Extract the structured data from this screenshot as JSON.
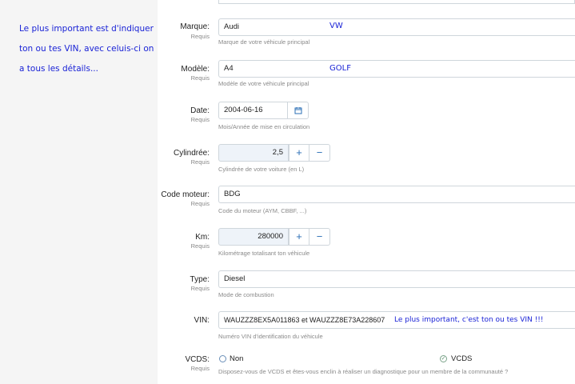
{
  "side_note": "Le plus important est d'indiquer ton ou tes VIN, avec celuis-ci on a tous les détails...",
  "required_label": "Requis",
  "fields": {
    "marque": {
      "label": "Marque:",
      "value": "Audi",
      "hint": "Marque de votre véhicule principal",
      "annotation": "VW"
    },
    "modele": {
      "label": "Modèle:",
      "value": "A4",
      "hint": "Modèle de votre véhicule principal",
      "annotation": "GOLF"
    },
    "date": {
      "label": "Date:",
      "value": "2004-06-16",
      "hint": "Mois/Année de mise en circulation"
    },
    "cylindree": {
      "label": "Cylindrée:",
      "value": "2,5",
      "hint": "Cylindrée de votre voiture (en L)"
    },
    "code_moteur": {
      "label": "Code moteur:",
      "value": "BDG",
      "hint": "Code du moteur (AYM, CBBF, ...)"
    },
    "km": {
      "label": "Km:",
      "value": "280000",
      "hint": "Kilométrage totalisant ton véhicule"
    },
    "type": {
      "label": "Type:",
      "value": "Diesel",
      "hint": "Mode de combustion"
    },
    "vin": {
      "label": "VIN:",
      "value": "WAUZZZ8EX5A011863 et WAUZZZ8E73A228607",
      "hint": "Numéro VIN d'identification du véhicule",
      "annotation": "Le plus important, c'est ton ou tes VIN !!!"
    },
    "vcds": {
      "label": "VCDS:",
      "option_no": "Non",
      "option_yes": "VCDS",
      "selected": "VCDS",
      "hint": "Disposez-vous de VCDS et êtes-vous enclin à réaliser un diagnostique pour un membre de la communauté ?"
    }
  },
  "steppers": {
    "plus": "+",
    "minus": "−"
  },
  "icons": {
    "calendar": "calendar-icon",
    "check": "check-icon"
  }
}
